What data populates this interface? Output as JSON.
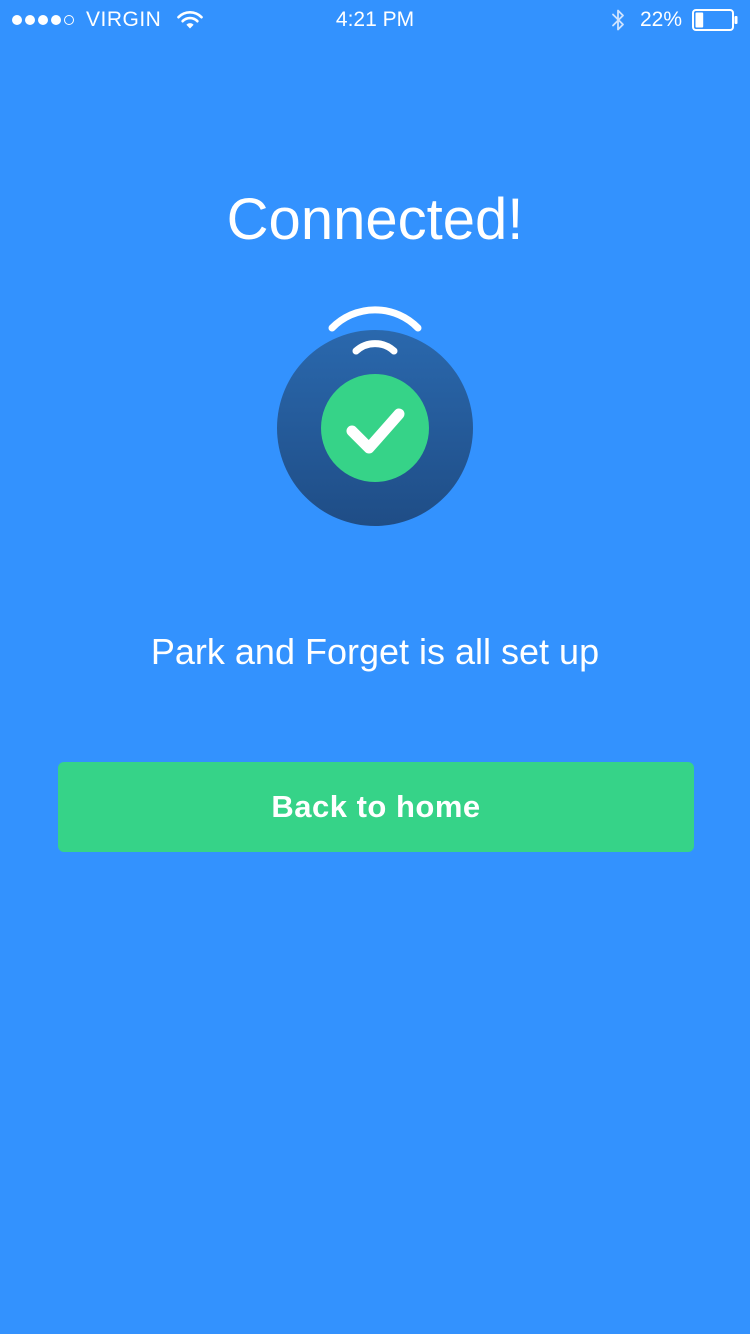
{
  "status_bar": {
    "carrier": "VIRGIN",
    "signal_bars_filled": 4,
    "signal_bars_total": 5,
    "time": "4:21 PM",
    "battery_percent_label": "22%",
    "battery_level": 0.22,
    "icons": [
      "signal-dots",
      "wifi-icon",
      "bluetooth-icon",
      "battery-icon"
    ]
  },
  "screen": {
    "title": "Connected!",
    "message": "Park and Forget is all set up",
    "illustration_icons": [
      "wireless-signal-icon",
      "checkmark-icon"
    ]
  },
  "actions": {
    "back_home_label": "Back to home"
  },
  "colors": {
    "background": "#3392fe",
    "button": "#36d388",
    "device_top": "#2a68ad",
    "device_bottom": "#1f4d86",
    "check_badge": "#36d388",
    "text": "#ffffff"
  }
}
